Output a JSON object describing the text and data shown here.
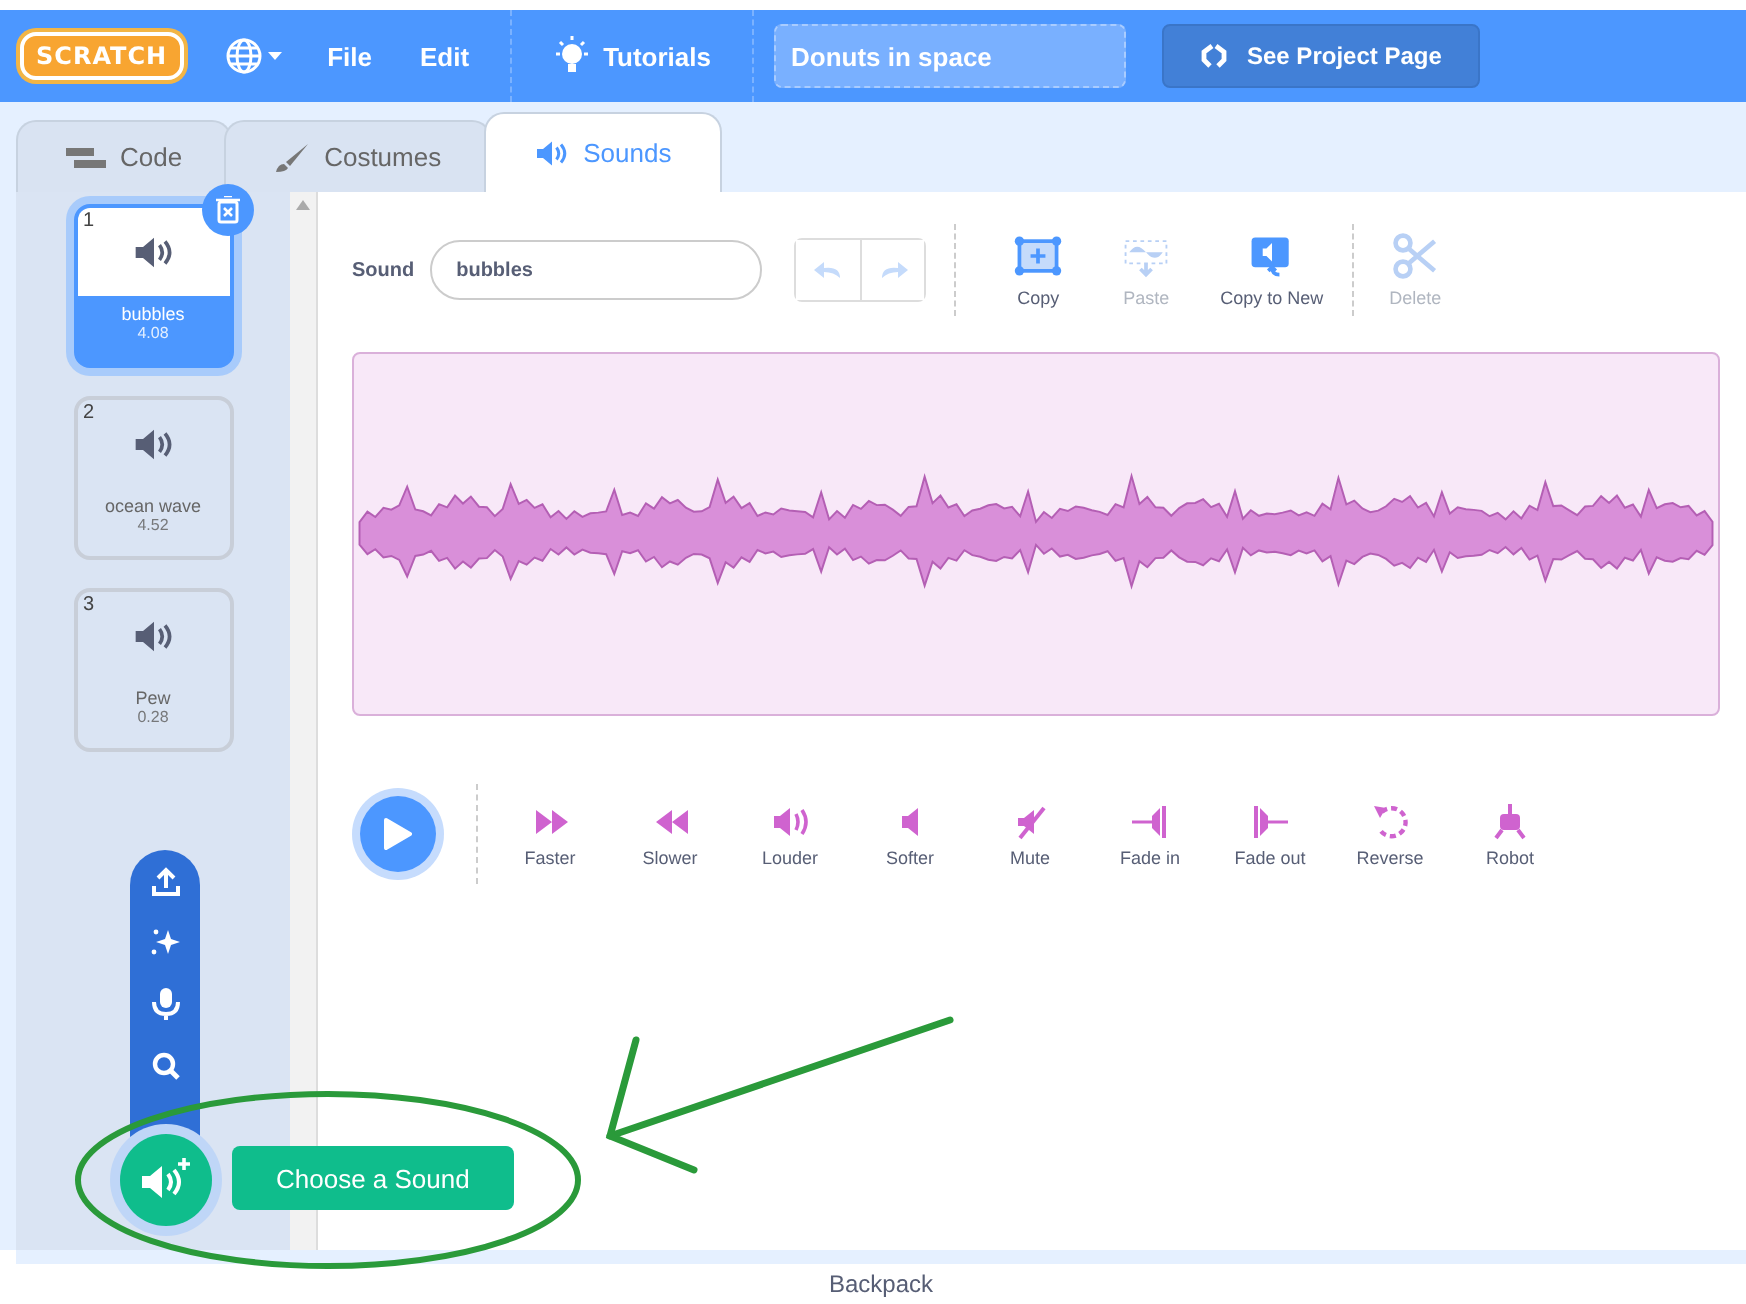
{
  "menu_bar": {
    "logo": "SCRATCH",
    "items": [
      "File",
      "Edit"
    ],
    "tutorials": "Tutorials",
    "project_title": {
      "value": "Donuts in space"
    },
    "project_page_button": "See Project Page"
  },
  "tabs": [
    {
      "label": "Code",
      "kind": "code",
      "selected": false
    },
    {
      "label": "Costumes",
      "kind": "costumes",
      "selected": false
    },
    {
      "label": "Sounds",
      "kind": "sounds",
      "selected": true
    }
  ],
  "sounds": [
    {
      "number": "1",
      "name": "bubbles",
      "duration": "4.08",
      "selected": true
    },
    {
      "number": "2",
      "name": "ocean wave",
      "duration": "4.52",
      "selected": false
    },
    {
      "number": "3",
      "name": "Pew",
      "duration": "0.28",
      "selected": false
    }
  ],
  "editor": {
    "sound_label": "Sound",
    "sound_name": {
      "value": "bubbles"
    },
    "undo_disabled": true,
    "redo_disabled": true,
    "tools": [
      {
        "label": "Copy",
        "kind": "copy",
        "disabled": false
      },
      {
        "label": "Paste",
        "kind": "paste",
        "disabled": true
      },
      {
        "label": "Copy to New",
        "kind": "copy_new",
        "disabled": false
      },
      {
        "label": "Delete",
        "kind": "delete",
        "disabled": true
      }
    ],
    "effects": [
      {
        "label": "Faster",
        "kind": "faster"
      },
      {
        "label": "Slower",
        "kind": "slower"
      },
      {
        "label": "Louder",
        "kind": "louder"
      },
      {
        "label": "Softer",
        "kind": "softer"
      },
      {
        "label": "Mute",
        "kind": "mute"
      },
      {
        "label": "Fade in",
        "kind": "fade_in"
      },
      {
        "label": "Fade out",
        "kind": "fade_out"
      },
      {
        "label": "Reverse",
        "kind": "reverse"
      },
      {
        "label": "Robot",
        "kind": "robot"
      }
    ]
  },
  "add_sound_menu": {
    "tooltip": "Choose a Sound"
  },
  "footer": {
    "label": "Backpack"
  }
}
